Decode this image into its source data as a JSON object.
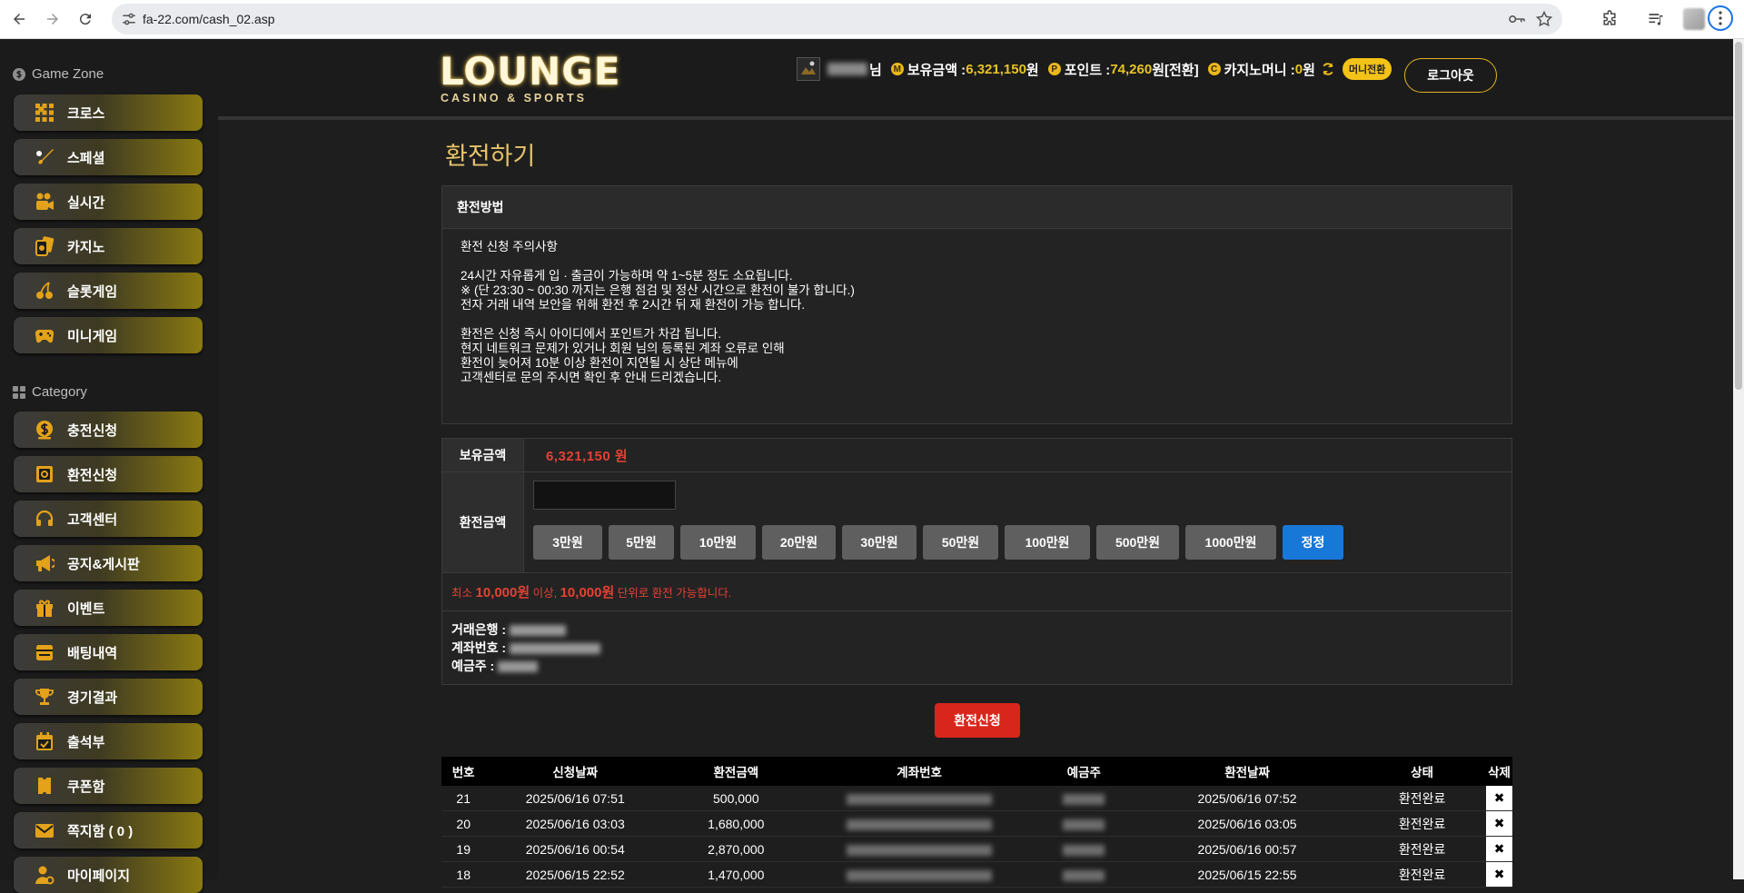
{
  "browser": {
    "url": "fa-22.com/cash_02.asp"
  },
  "sidebar": {
    "game_zone_title": "Game Zone",
    "game_items": [
      {
        "label": "크로스",
        "icon": "cross-grid-icon"
      },
      {
        "label": "스페셜",
        "icon": "bat-ball-icon"
      },
      {
        "label": "실시간",
        "icon": "video-camera-icon"
      },
      {
        "label": "카지노",
        "icon": "cards-icon"
      },
      {
        "label": "슬롯게임",
        "icon": "cherry-icon"
      },
      {
        "label": "미니게임",
        "icon": "gamepad-icon"
      }
    ],
    "category_title": "Category",
    "category_items": [
      {
        "label": "충전신청",
        "icon": "coin-bag-icon"
      },
      {
        "label": "환전신청",
        "icon": "safe-icon"
      },
      {
        "label": "고객센터",
        "icon": "headset-icon"
      },
      {
        "label": "공지&게시판",
        "icon": "megaphone-icon"
      },
      {
        "label": "이벤트",
        "icon": "gift-icon"
      },
      {
        "label": "배팅내역",
        "icon": "wallet-icon"
      },
      {
        "label": "경기결과",
        "icon": "trophy-icon"
      },
      {
        "label": "출석부",
        "icon": "calendar-icon"
      },
      {
        "label": "쿠폰함",
        "icon": "ticket-icon"
      },
      {
        "label": "쪽지함 ( 0 )",
        "icon": "envelope-icon"
      },
      {
        "label": "마이페이지",
        "icon": "user-gear-icon"
      }
    ]
  },
  "header": {
    "logo": "LOUNGE",
    "logo_sub": "CASINO & SPORTS",
    "user_suffix": "님",
    "balance_label": "보유금액 : ",
    "balance_value": "6,321,150",
    "won": "원",
    "point_label": "포인트 : ",
    "point_value": "74,260",
    "point_convert": " [전환]",
    "casino_label": "카지노머니 : ",
    "casino_value": "0",
    "money_convert": "머니전환",
    "logout": "로그아웃"
  },
  "page": {
    "title": "환전하기",
    "method_title": "환전방법",
    "method_lines_1": [
      "환전 신청 주의사항"
    ],
    "method_lines_2": [
      "24시간 자유롭게 입 · 출금이 가능하며 약 1~5분 정도 소요됩니다.",
      "※ (단 23:30 ~ 00:30 까지는 은행 점검 및 정산 시간으로 환전이 불가 합니다.)",
      "전자 거래 내역 보안을 위해 환전 후 2시간 뒤 재 환전이 가능 합니다."
    ],
    "method_lines_3": [
      "환전은 신청 즉시 아이디에서 포인트가 차감 됩니다.",
      "현지 네트워크 문제가 있거나 회원 님의 등록된 계좌 오류로 인해",
      "환전이 늦어져 10분 이상 환전이 지연될 시 상단 메뉴에",
      "고객센터로 문의 주시면 확인 후 안내 드리겠습니다."
    ],
    "held_label": "보유금액",
    "held_value": "6,321,150 원",
    "exchange_label": "환전금액",
    "amount_buttons": [
      "3만원",
      "5만원",
      "10만원",
      "20만원",
      "30만원",
      "50만원",
      "100만원",
      "500만원",
      "1000만원"
    ],
    "fix_button": "정정",
    "min_pre": "최소 ",
    "min_amount": "10,000원",
    "min_mid": " 이상, ",
    "unit_amount": "10,000원",
    "min_post": " 단위로 환전 가능합니다.",
    "bank_label": "거래은행 : ",
    "account_label": "계좌번호 : ",
    "holder_label": "예금주 : ",
    "apply_button": "환전신청"
  },
  "history": {
    "headers": [
      "번호",
      "신청날짜",
      "환전금액",
      "계좌번호",
      "예금주",
      "환전날짜",
      "상태",
      "삭제"
    ],
    "rows": [
      {
        "no": "21",
        "req": "2025/06/16 07:51",
        "amt": "500,000",
        "done": "2025/06/16 07:52",
        "status": "환전완료"
      },
      {
        "no": "20",
        "req": "2025/06/16 03:03",
        "amt": "1,680,000",
        "done": "2025/06/16 03:05",
        "status": "환전완료"
      },
      {
        "no": "19",
        "req": "2025/06/16 00:54",
        "amt": "2,870,000",
        "done": "2025/06/16 00:57",
        "status": "환전완료"
      },
      {
        "no": "18",
        "req": "2025/06/15 22:52",
        "amt": "1,470,000",
        "done": "2025/06/15 22:55",
        "status": "환전완료"
      }
    ],
    "delete_glyph": "✖"
  },
  "colors": {
    "accent_gold": "#e8c323",
    "danger_red": "#e34234",
    "fix_blue": "#1878d8",
    "apply_red": "#d9261c"
  }
}
